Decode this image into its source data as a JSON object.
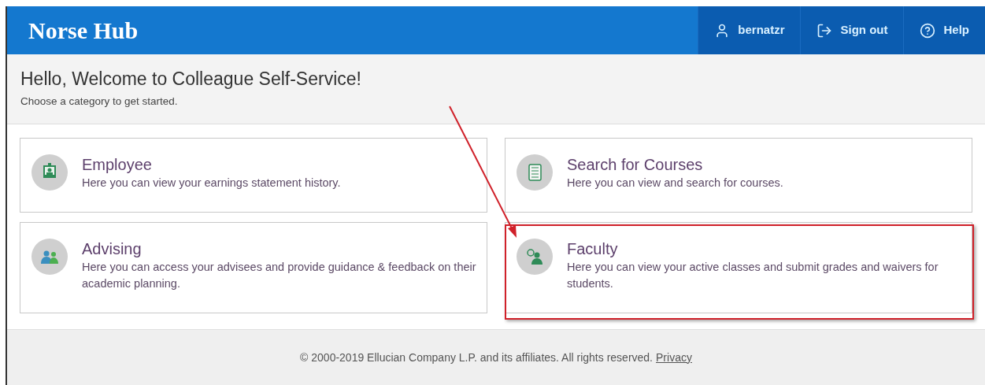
{
  "header": {
    "title": "Norse Hub",
    "nav": [
      {
        "kind": "user",
        "label": "bernatzr"
      },
      {
        "kind": "signout",
        "label": "Sign out"
      },
      {
        "kind": "help",
        "label": "Help"
      }
    ]
  },
  "welcome": {
    "title": "Hello, Welcome to Colleague Self-Service!",
    "subtitle": "Choose a category to get started."
  },
  "cards": [
    {
      "kind": "badge",
      "title": "Employee",
      "description": "Here you can view your earnings statement history.",
      "highlighted": false
    },
    {
      "kind": "notebook",
      "title": "Search for Courses",
      "description": "Here you can view and search for courses.",
      "highlighted": false
    },
    {
      "kind": "group",
      "title": "Advising",
      "description": "Here you can access your advisees and provide guidance & feedback on their academic planning.",
      "highlighted": false
    },
    {
      "kind": "faculty",
      "title": "Faculty",
      "description": "Here you can view your active classes and submit grades and waivers for students.",
      "highlighted": true
    }
  ],
  "annotation": {
    "arrow": true
  },
  "footer": {
    "text": "© 2000-2019 Ellucian Company L.P. and its affiliates. All rights reserved.",
    "link": "Privacy"
  }
}
